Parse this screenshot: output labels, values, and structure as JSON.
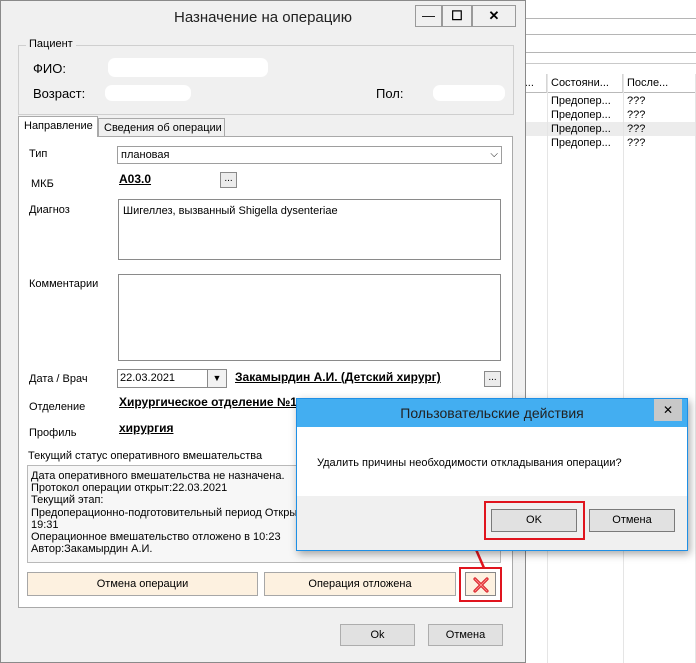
{
  "window": {
    "title": "Назначение на операцию",
    "minimize": "—",
    "maximize": "☐",
    "close": "✕"
  },
  "patient": {
    "group_label": "Пациент",
    "fio_label": "ФИО:",
    "age_label": "Возраст:",
    "sex_label": "Пол:"
  },
  "tabs": [
    {
      "label": "Направление"
    },
    {
      "label": "Сведения об операции"
    }
  ],
  "form": {
    "type_label": "Тип",
    "type_value": "плановая",
    "mkb_label": "МКБ",
    "mkb_value": "A03.0",
    "diagnosis_label": "Диагноз",
    "diagnosis_value": "Шигеллез, вызванный Shigella dysenteriae",
    "comments_label": "Комментарии",
    "date_doctor_label": "Дата / Врач",
    "date_value": "22.03.2021",
    "doctor_value": "Закамырдин А.И. (Детский хирург)",
    "department_label": "Отделение",
    "department_value": "Хирургическое отделение №1",
    "profile_label": "Профиль",
    "profile_value": "хирургия",
    "ellipsis": "..."
  },
  "status": {
    "title": "Текущий статус оперативного вмешательства",
    "lines": [
      "Дата оперативного вмешательства не назначена.",
      "Протокол операции открыт:22.03.2021",
      "Текущий этап:",
      "Предоперационно-подготовительный период Открыт 22.03.2021",
      "19:31",
      "Операционное вмешательство отложено в 10:23",
      "Автор:Закамырдин А.И."
    ]
  },
  "actions": {
    "cancel_operation": "Отмена операции",
    "operation_postponed": "Операция отложена"
  },
  "footer": {
    "ok": "Ok",
    "cancel": "Отмена"
  },
  "dialog": {
    "title": "Пользовательские действия",
    "close": "✕",
    "message": "Удалить причины необходимости откладывания операции?",
    "ok": "OK",
    "cancel": "Отмена"
  },
  "background_table": {
    "headers": [
      "ч...",
      "Состояни...",
      "После..."
    ],
    "rows": [
      [
        "",
        "Предопер...",
        "???"
      ],
      [
        "",
        "Предопер...",
        "???"
      ],
      [
        "",
        "Предопер...",
        "???"
      ],
      [
        "",
        "Предопер...",
        "???"
      ]
    ]
  },
  "colors": {
    "accent_red": "#e0141e",
    "dialog_title": "#43aef1",
    "cream_button": "#fdf1e0"
  }
}
